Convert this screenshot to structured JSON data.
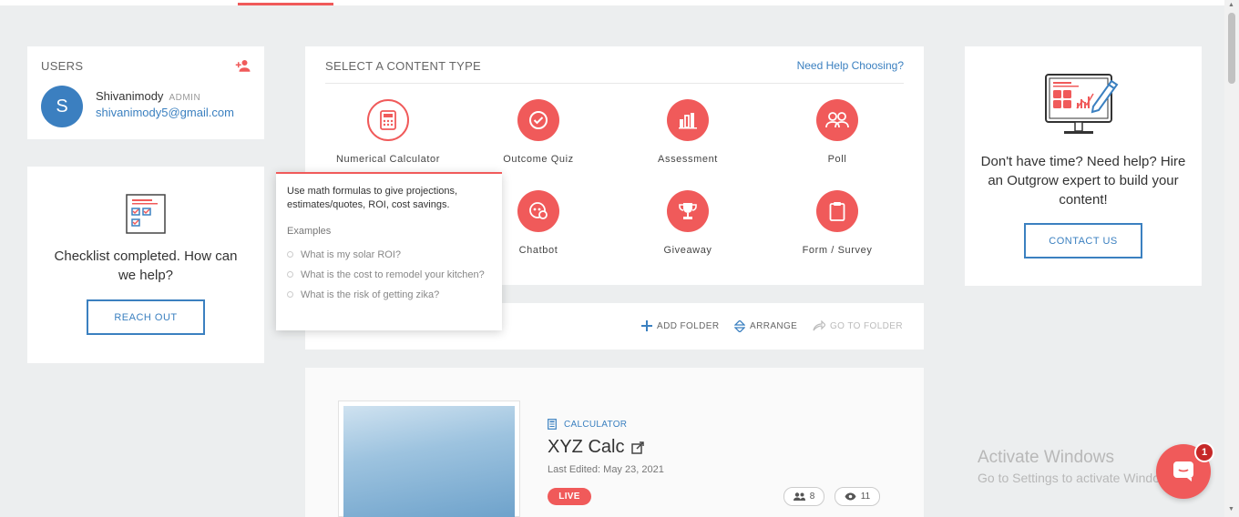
{
  "users": {
    "header": "USERS",
    "avatar_letter": "S",
    "name": "Shivanimody",
    "role": "ADMIN",
    "email": "shivanimody5@gmail.com"
  },
  "checklist": {
    "text": "Checklist completed. How can we help?",
    "button": "REACH OUT"
  },
  "content_type": {
    "header": "SELECT A CONTENT TYPE",
    "help_link": "Need Help Choosing?",
    "items": [
      {
        "label": "Numerical Calculator",
        "icon": "calculator-icon"
      },
      {
        "label": "Outcome Quiz",
        "icon": "check-circle-icon"
      },
      {
        "label": "Assessment",
        "icon": "bar-chart-icon"
      },
      {
        "label": "Poll",
        "icon": "users-icon"
      },
      {
        "label": "Chatbot",
        "icon": "chat-icon"
      },
      {
        "label": "Giveaway",
        "icon": "trophy-icon"
      },
      {
        "label": "Form / Survey",
        "icon": "clipboard-icon"
      }
    ]
  },
  "tooltip": {
    "description": "Use math formulas to give projections, estimates/quotes, ROI, cost savings.",
    "examples_header": "Examples",
    "examples": [
      "What is my solar ROI?",
      "What is the cost to remodel your kitchen?",
      "What is the risk of getting zika?"
    ]
  },
  "folder_bar": {
    "add_folder": "ADD FOLDER",
    "arrange": "ARRANGE",
    "go_to_folder": "GO TO FOLDER"
  },
  "hire": {
    "text": "Don't have time? Need help? Hire an Outgrow expert to build your content!",
    "button": "CONTACT US"
  },
  "calc_card": {
    "category": "CALCULATOR",
    "title": "XYZ Calc",
    "last_edited": "Last Edited: May 23, 2021",
    "status": "LIVE",
    "users_count": "8",
    "views_count": "11"
  },
  "watermark": {
    "line1": "Activate Windows",
    "line2": "Go to Settings to activate Windows."
  },
  "chat": {
    "badge": "1"
  },
  "colors": {
    "accent": "#f05a5a",
    "link": "#3b80c0",
    "background": "#eceeef"
  }
}
